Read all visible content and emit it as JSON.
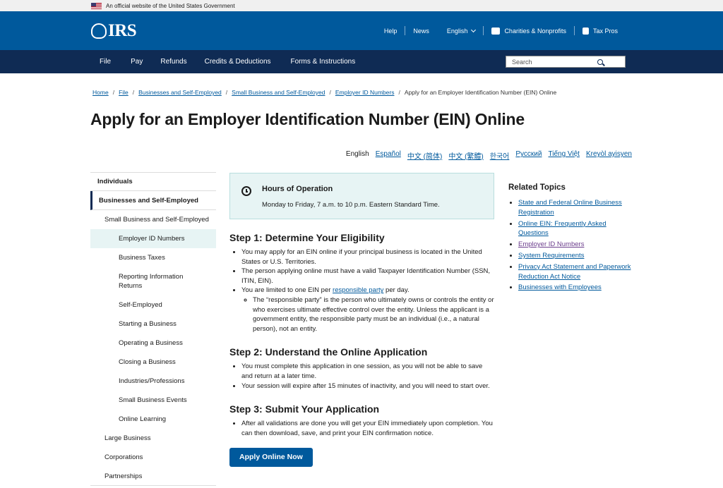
{
  "gov_banner": {
    "text": "An official website of the United States Government"
  },
  "header": {
    "logo": "IRS",
    "links": [
      "Help",
      "News"
    ],
    "language": "English",
    "charities": "Charities & Nonprofits",
    "taxpros": "Tax Pros"
  },
  "nav": {
    "items": [
      "File",
      "Pay",
      "Refunds",
      "Credits & Deductions",
      "Forms & Instructions"
    ],
    "search_placeholder": "Search"
  },
  "breadcrumb": [
    "Home",
    "File",
    "Businesses and Self-Employed",
    "Small Business and Self-Employed",
    "Employer ID Numbers",
    "Apply for an Employer Identification Number (EIN) Online"
  ],
  "page_title": "Apply for an Employer Identification Number (EIN) Online",
  "languages": [
    "English",
    "Español",
    "中文 (简体)",
    "中文 (繁體)",
    "한국어",
    "Русский",
    "Tiếng Việt",
    "Kreyòl ayisyen"
  ],
  "sidebar": {
    "items": [
      "Individuals",
      "Businesses and Self-Employed",
      "Small Business and Self-Employed",
      "Employer ID Numbers",
      "Business Taxes",
      "Reporting Information Returns",
      "Self-Employed",
      "Starting a Business",
      "Operating a Business",
      "Closing a Business",
      "Industries/Professions",
      "Small Business Events",
      "Online Learning",
      "Large Business",
      "Corporations",
      "Partnerships"
    ]
  },
  "hours": {
    "title": "Hours of Operation",
    "text": "Monday to Friday, 7 a.m. to 10 p.m. Eastern Standard Time."
  },
  "step1": {
    "title": "Step 1: Determine Your Eligibility",
    "b1": "You may apply for an EIN online if your principal business is located in the United States or U.S. Territories.",
    "b2": "The person applying online must have a valid Taxpayer Identification Number (SSN, ITIN, EIN).",
    "b3_pre": "You are limited to one EIN per ",
    "b3_link": "responsible party",
    "b3_post": " per day.",
    "sub": "The “responsible party” is the person who ultimately owns or controls the entity or who exercises ultimate effective control over the entity. Unless the applicant is a government entity, the responsible party must be an individual (i.e., a natural person), not an entity."
  },
  "step2": {
    "title": "Step 2: Understand the Online Application",
    "b1": "You must complete this application in one session, as you will not be able to save and return at a later time.",
    "b2": "Your session will expire after 15 minutes of inactivity, and you will need to start over."
  },
  "step3": {
    "title": "Step 3: Submit Your Application",
    "b1": "After all validations are done you will get your EIN immediately upon completion. You can then download, save, and print your EIN confirmation notice."
  },
  "apply_button": "Apply Online Now",
  "related": {
    "title": "Related Topics",
    "links": [
      "State and Federal Online Business Registration",
      "Online EIN: Frequently Asked Questions",
      "Employer ID Numbers",
      "System Requirements",
      "Privacy Act Statement and Paperwork Reduction Act Notice",
      "Businesses with Employees"
    ]
  }
}
